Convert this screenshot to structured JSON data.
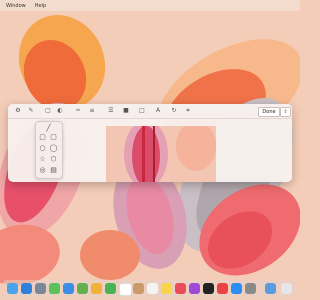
{
  "menubar": {
    "items": [
      "Window",
      "Help"
    ]
  },
  "colors": {
    "wallpaper_bg": "#f4cdb8",
    "window_bg": "#f8f1ee",
    "accent_red": "#d9404a",
    "accent_orange": "#f39a5c",
    "accent_pink": "#ec6f9b"
  },
  "markup_toolbar": {
    "icons": [
      "sketch-icon",
      "draw-icon",
      "shapes-icon",
      "highlight-icon",
      "pen-icon",
      "adjust-icon",
      "border-style-icon",
      "fill-color-icon",
      "text-style-icon",
      "rotate-left-icon",
      "rotate-right-icon",
      "crop-icon"
    ],
    "done_label": "Done",
    "share_label": "⇪"
  },
  "shapes_popover": {
    "shapes": [
      "line",
      "rectangle",
      "rounded-rectangle",
      "oval",
      "speech-bubble",
      "star",
      "polygon",
      "loupe"
    ]
  },
  "dock": {
    "apps": [
      "Finder",
      "Safari",
      "Photos",
      "Messages",
      "Mail",
      "Maps",
      "Photos-2",
      "FaceTime",
      "Calendar",
      "Contacts",
      "Reminders",
      "Notes",
      "Music",
      "Podcasts",
      "Apple TV",
      "News",
      "App Store",
      "System Preferences",
      "Downloads",
      "Trash"
    ]
  }
}
